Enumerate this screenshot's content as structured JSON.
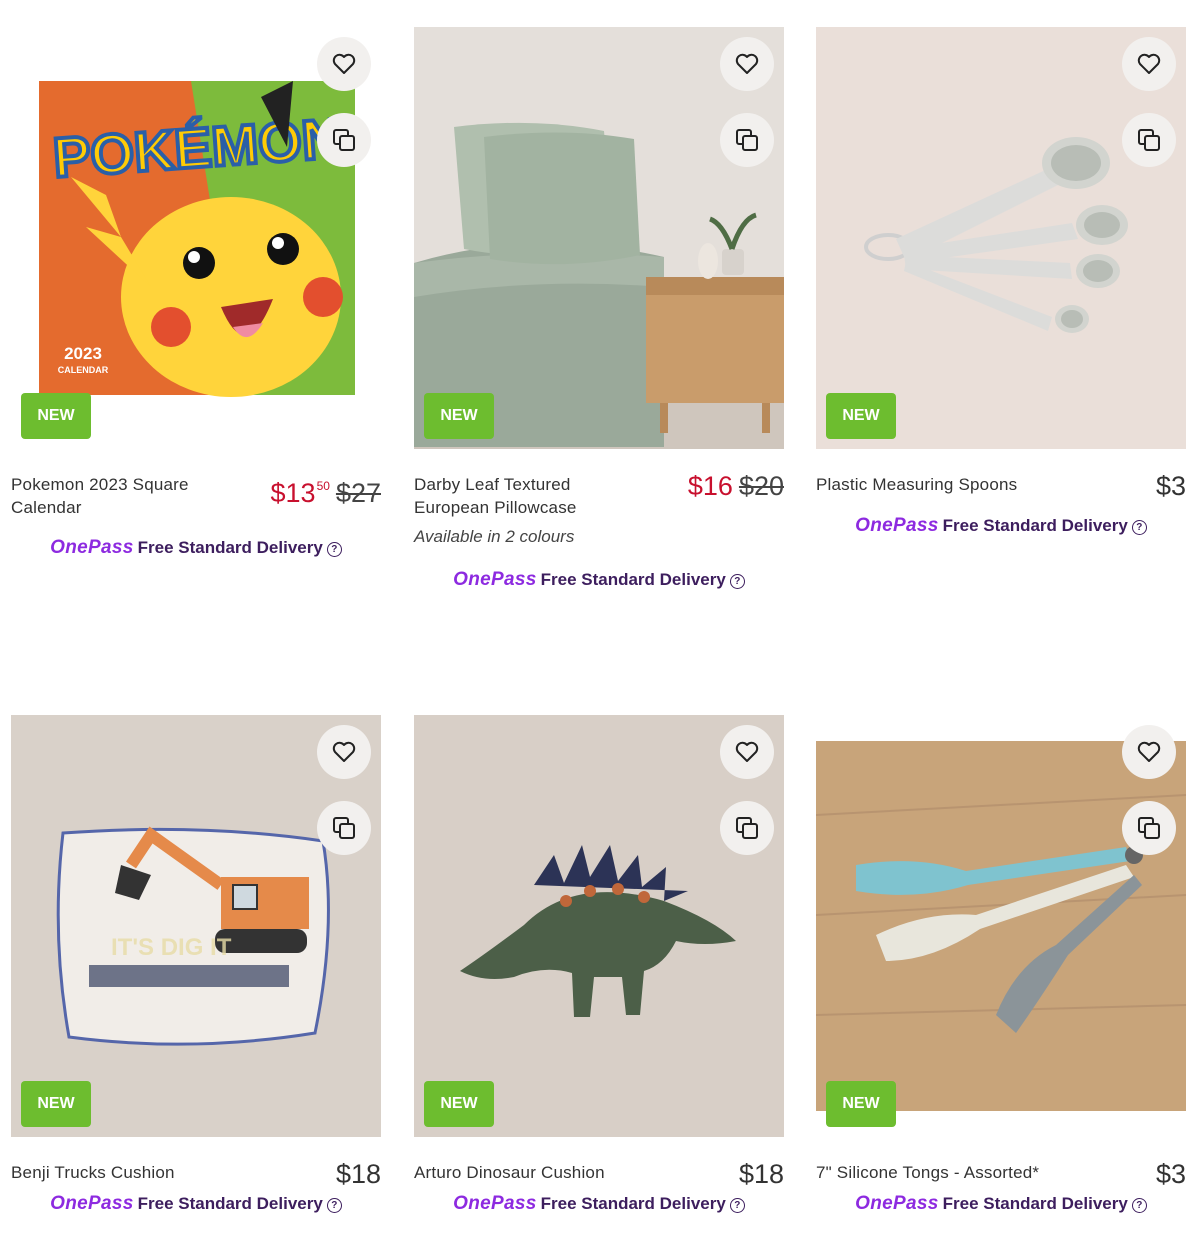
{
  "products": [
    {
      "name": "Pokemon 2023 Square Calendar",
      "price_main": "$13",
      "price_cents": "50",
      "was_price": "$27",
      "badge": "NEW",
      "calendar_brand": "POKÉMON",
      "calendar_year": "2023",
      "calendar_label": "CALENDAR"
    },
    {
      "name": "Darby Leaf Textured European Pillowcase",
      "price_main": "$16",
      "was_price": "$20",
      "badge": "NEW",
      "colours_note": "Available in 2 colours"
    },
    {
      "name": "Plastic Measuring Spoons",
      "price": "$3",
      "badge": "NEW"
    },
    {
      "name": "Benji Trucks Cushion",
      "price": "$18",
      "badge": "NEW"
    },
    {
      "name": "Arturo Dinosaur Cushion",
      "price": "$18",
      "badge": "NEW"
    },
    {
      "name": "7\" Silicone Tongs - Assorted*",
      "price": "$3",
      "badge": "NEW"
    }
  ],
  "onepass": {
    "brand": "OnePass",
    "text": "Free Standard Delivery",
    "help": "?"
  },
  "icons": {
    "wishlist": "heart-icon",
    "compare": "compare-icon",
    "help": "question-circle-icon"
  },
  "colors": {
    "sale_red": "#c8102e",
    "new_badge": "#6dbd2f",
    "onepass_purple": "#8d2ae0",
    "delivery_text": "#3d1e5e"
  }
}
